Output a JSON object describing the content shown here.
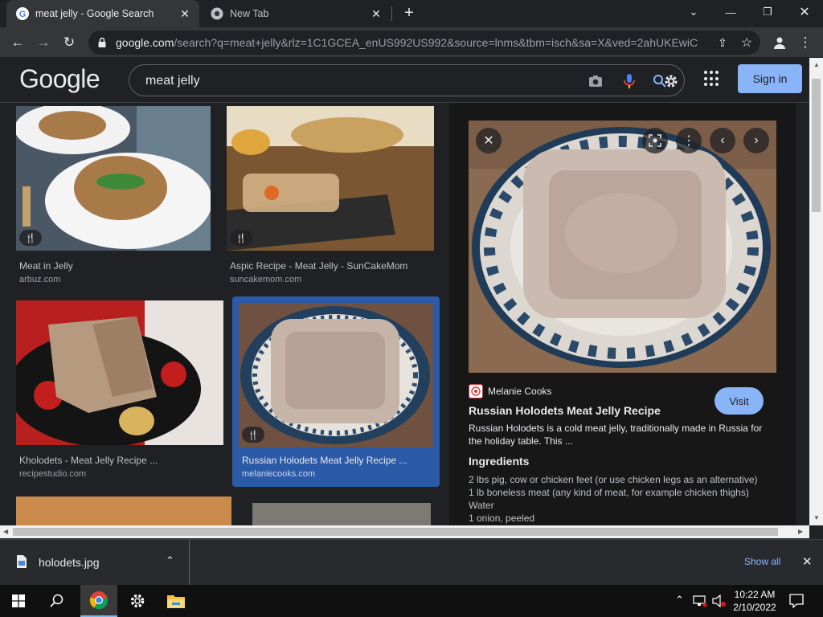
{
  "browser": {
    "tabs": [
      {
        "title": "meat jelly - Google Search",
        "active": true
      },
      {
        "title": "New Tab",
        "active": false
      }
    ],
    "url_host": "google.com",
    "url_rest": "/search?q=meat+jelly&rlz=1C1GCEA_enUS992US992&source=lnms&tbm=isch&sa=X&ved=2ahUKEwiCx..."
  },
  "google": {
    "logo": "Google",
    "query": "meat jelly",
    "signin_label": "Sign in"
  },
  "results": [
    {
      "title": "Meat in Jelly",
      "source": "arbuz.com"
    },
    {
      "title": "Aspic Recipe - Meat Jelly - SunCakeMom",
      "source": "suncakemom.com"
    },
    {
      "title": "Kholodets - Meat Jelly Recipe ...",
      "source": "recipestudio.com"
    },
    {
      "title": "Russian Holodets Meat Jelly Recipe ...",
      "source": "melaniecooks.com"
    }
  ],
  "panel": {
    "source_name": "Melanie Cooks",
    "visit_label": "Visit",
    "title": "Russian Holodets Meat Jelly Recipe",
    "description": "Russian Holodets is a cold meat jelly, traditionally made in Russia for the holiday table. This ...",
    "ingredients_heading": "Ingredients",
    "ingredients": [
      "2 lbs pig, cow or chicken feet (or use chicken legs as an alternative)",
      "1 lb boneless meat (any kind of meat, for example chicken thighs)",
      "Water",
      "1 onion, peeled"
    ]
  },
  "download": {
    "filename": "holodets.jpg",
    "show_all_label": "Show all"
  },
  "taskbar": {
    "time": "10:22 AM",
    "date": "2/10/2022"
  },
  "colors": {
    "accent": "#8ab4f8",
    "selected_card": "#2b5aa8",
    "page_bg": "#202124",
    "panel_bg": "#171717"
  },
  "icons": [
    "google-favicon",
    "chrome-favicon",
    "close-icon",
    "plus-icon",
    "chevron-down-icon",
    "minimize-icon",
    "restore-icon",
    "back-icon",
    "forward-icon",
    "reload-icon",
    "lock-icon",
    "share-icon",
    "star-icon",
    "profile-icon",
    "kebab-icon",
    "camera-icon",
    "mic-icon",
    "lens-icon",
    "settings-gear-icon",
    "apps-grid-icon",
    "recipe-icon",
    "windows-start-icon",
    "search-icon",
    "chrome-icon",
    "settings-icon",
    "file-explorer-icon",
    "network-icon",
    "volume-icon",
    "notification-icon"
  ]
}
